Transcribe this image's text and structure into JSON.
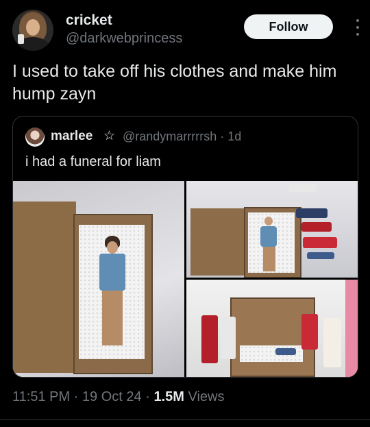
{
  "post": {
    "author_name": "cricket",
    "author_handle": "@darkwebprincess",
    "follow_label": "Follow",
    "text": "I used to take off his clothes and make him hump zayn",
    "time": "11:51 PM",
    "sep1": "·",
    "date": "19 Oct 24",
    "sep2": "·",
    "views_count": "1.5M",
    "views_label": "Views"
  },
  "quoted": {
    "author_name": "marlee",
    "badge": "☆",
    "author_handle": "@randymarrrrrsh · 1d",
    "text": "i had a funeral for liam",
    "images": [
      "doll-in-box-photo",
      "box-with-dolls-photo",
      "dolls-around-box-photo"
    ]
  },
  "icons": {
    "more": "more-options-icon",
    "star": "star-icon"
  },
  "colors": {
    "background": "#000000",
    "text": "#e7e9ea",
    "muted": "#71767b",
    "follow_bg": "#eff3f4",
    "border": "#2f3336"
  }
}
